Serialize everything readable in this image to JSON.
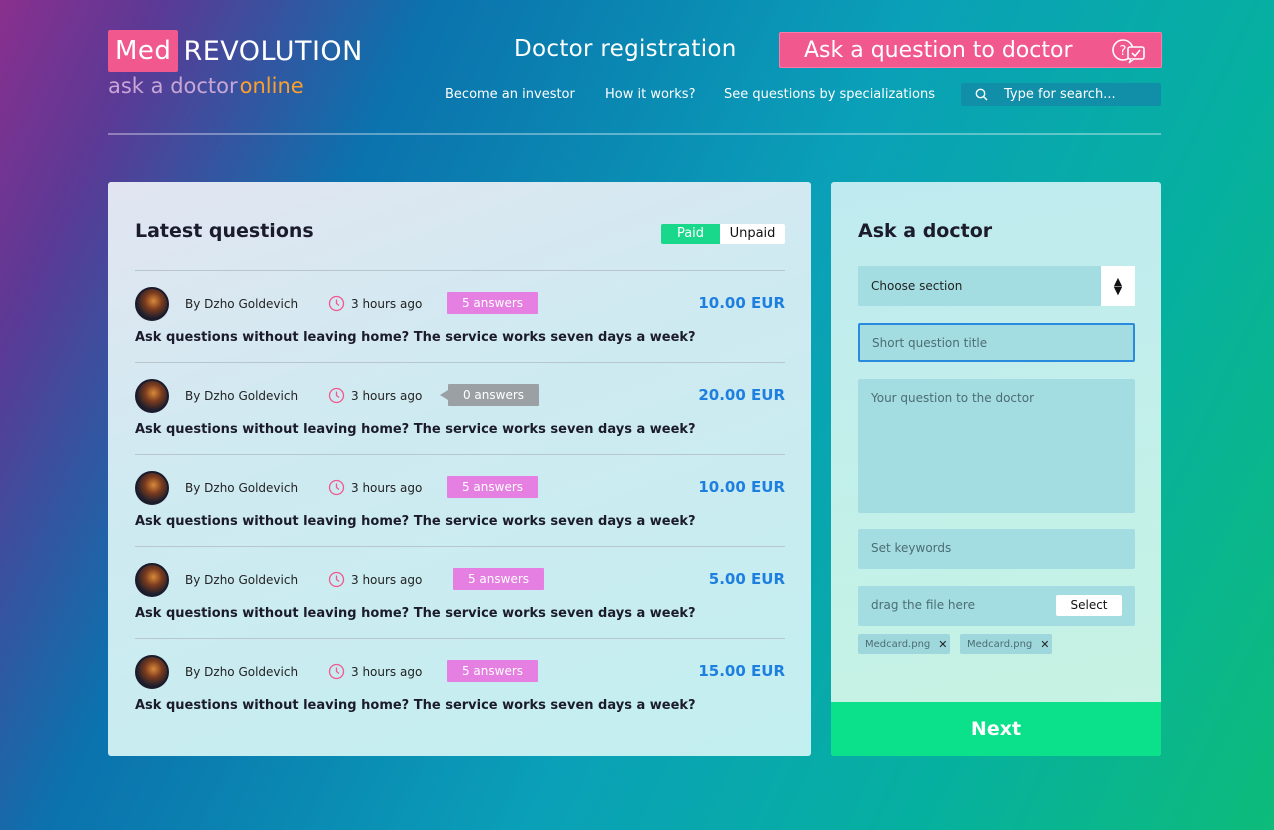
{
  "header": {
    "logo_med": "Med",
    "logo_revolution": "REVOLUTION",
    "logo_ask": "ask a doctor",
    "logo_online": "online",
    "doctor_registration": "Doctor registration",
    "ask_button": "Ask a question to doctor",
    "nav": [
      "Become an investor",
      "How it works?",
      "See questions by specializations"
    ],
    "search_placeholder": "Type for search..."
  },
  "latest": {
    "title": "Latest questions",
    "toggle_paid": "Paid",
    "toggle_unpaid": "Unpaid",
    "questions": [
      {
        "author": "By Dzho Goldevich",
        "time": "3 hours ago",
        "answers": "5 answers",
        "price": "10.00 EUR",
        "text": "Ask questions without leaving home? The service works seven days a week?"
      },
      {
        "author": "By Dzho Goldevich",
        "time": "3 hours ago",
        "answers": "0 answers",
        "price": "20.00 EUR",
        "text": "Ask questions without leaving home? The service works seven days a week?"
      },
      {
        "author": "By Dzho Goldevich",
        "time": "3 hours ago",
        "answers": "5 answers",
        "price": "10.00 EUR",
        "text": "Ask questions without leaving home? The service works seven days a week?"
      },
      {
        "author": "By Dzho Goldevich",
        "time": "3 hours ago",
        "answers": "5 answers",
        "price": "5.00 EUR",
        "text": "Ask questions without leaving home? The service works seven days a week?"
      },
      {
        "author": "By Dzho Goldevich",
        "time": "3 hours ago",
        "answers": "5 answers",
        "price": "15.00 EUR",
        "text": "Ask questions without leaving home? The service works seven days a week?"
      }
    ]
  },
  "ask_form": {
    "title": "Ask a doctor",
    "section_select": "Choose section",
    "title_placeholder": "Short question title",
    "question_placeholder": "Your question to the doctor",
    "keywords_placeholder": "Set keywords",
    "file_placeholder": "drag the file here",
    "select_button": "Select",
    "attachments": [
      "Medcard.png",
      "Medcard.png"
    ],
    "next_button": "Next"
  },
  "colors": {
    "accent_pink": "#f0588e",
    "accent_green": "#0be08a",
    "price_blue": "#1d7fe0",
    "badge_pink": "#e57fe2",
    "badge_gray": "#9aa0a4"
  },
  "icons": [
    "search-icon",
    "clock-icon",
    "question-chat-icon",
    "close-icon",
    "sort-arrows-icon"
  ]
}
